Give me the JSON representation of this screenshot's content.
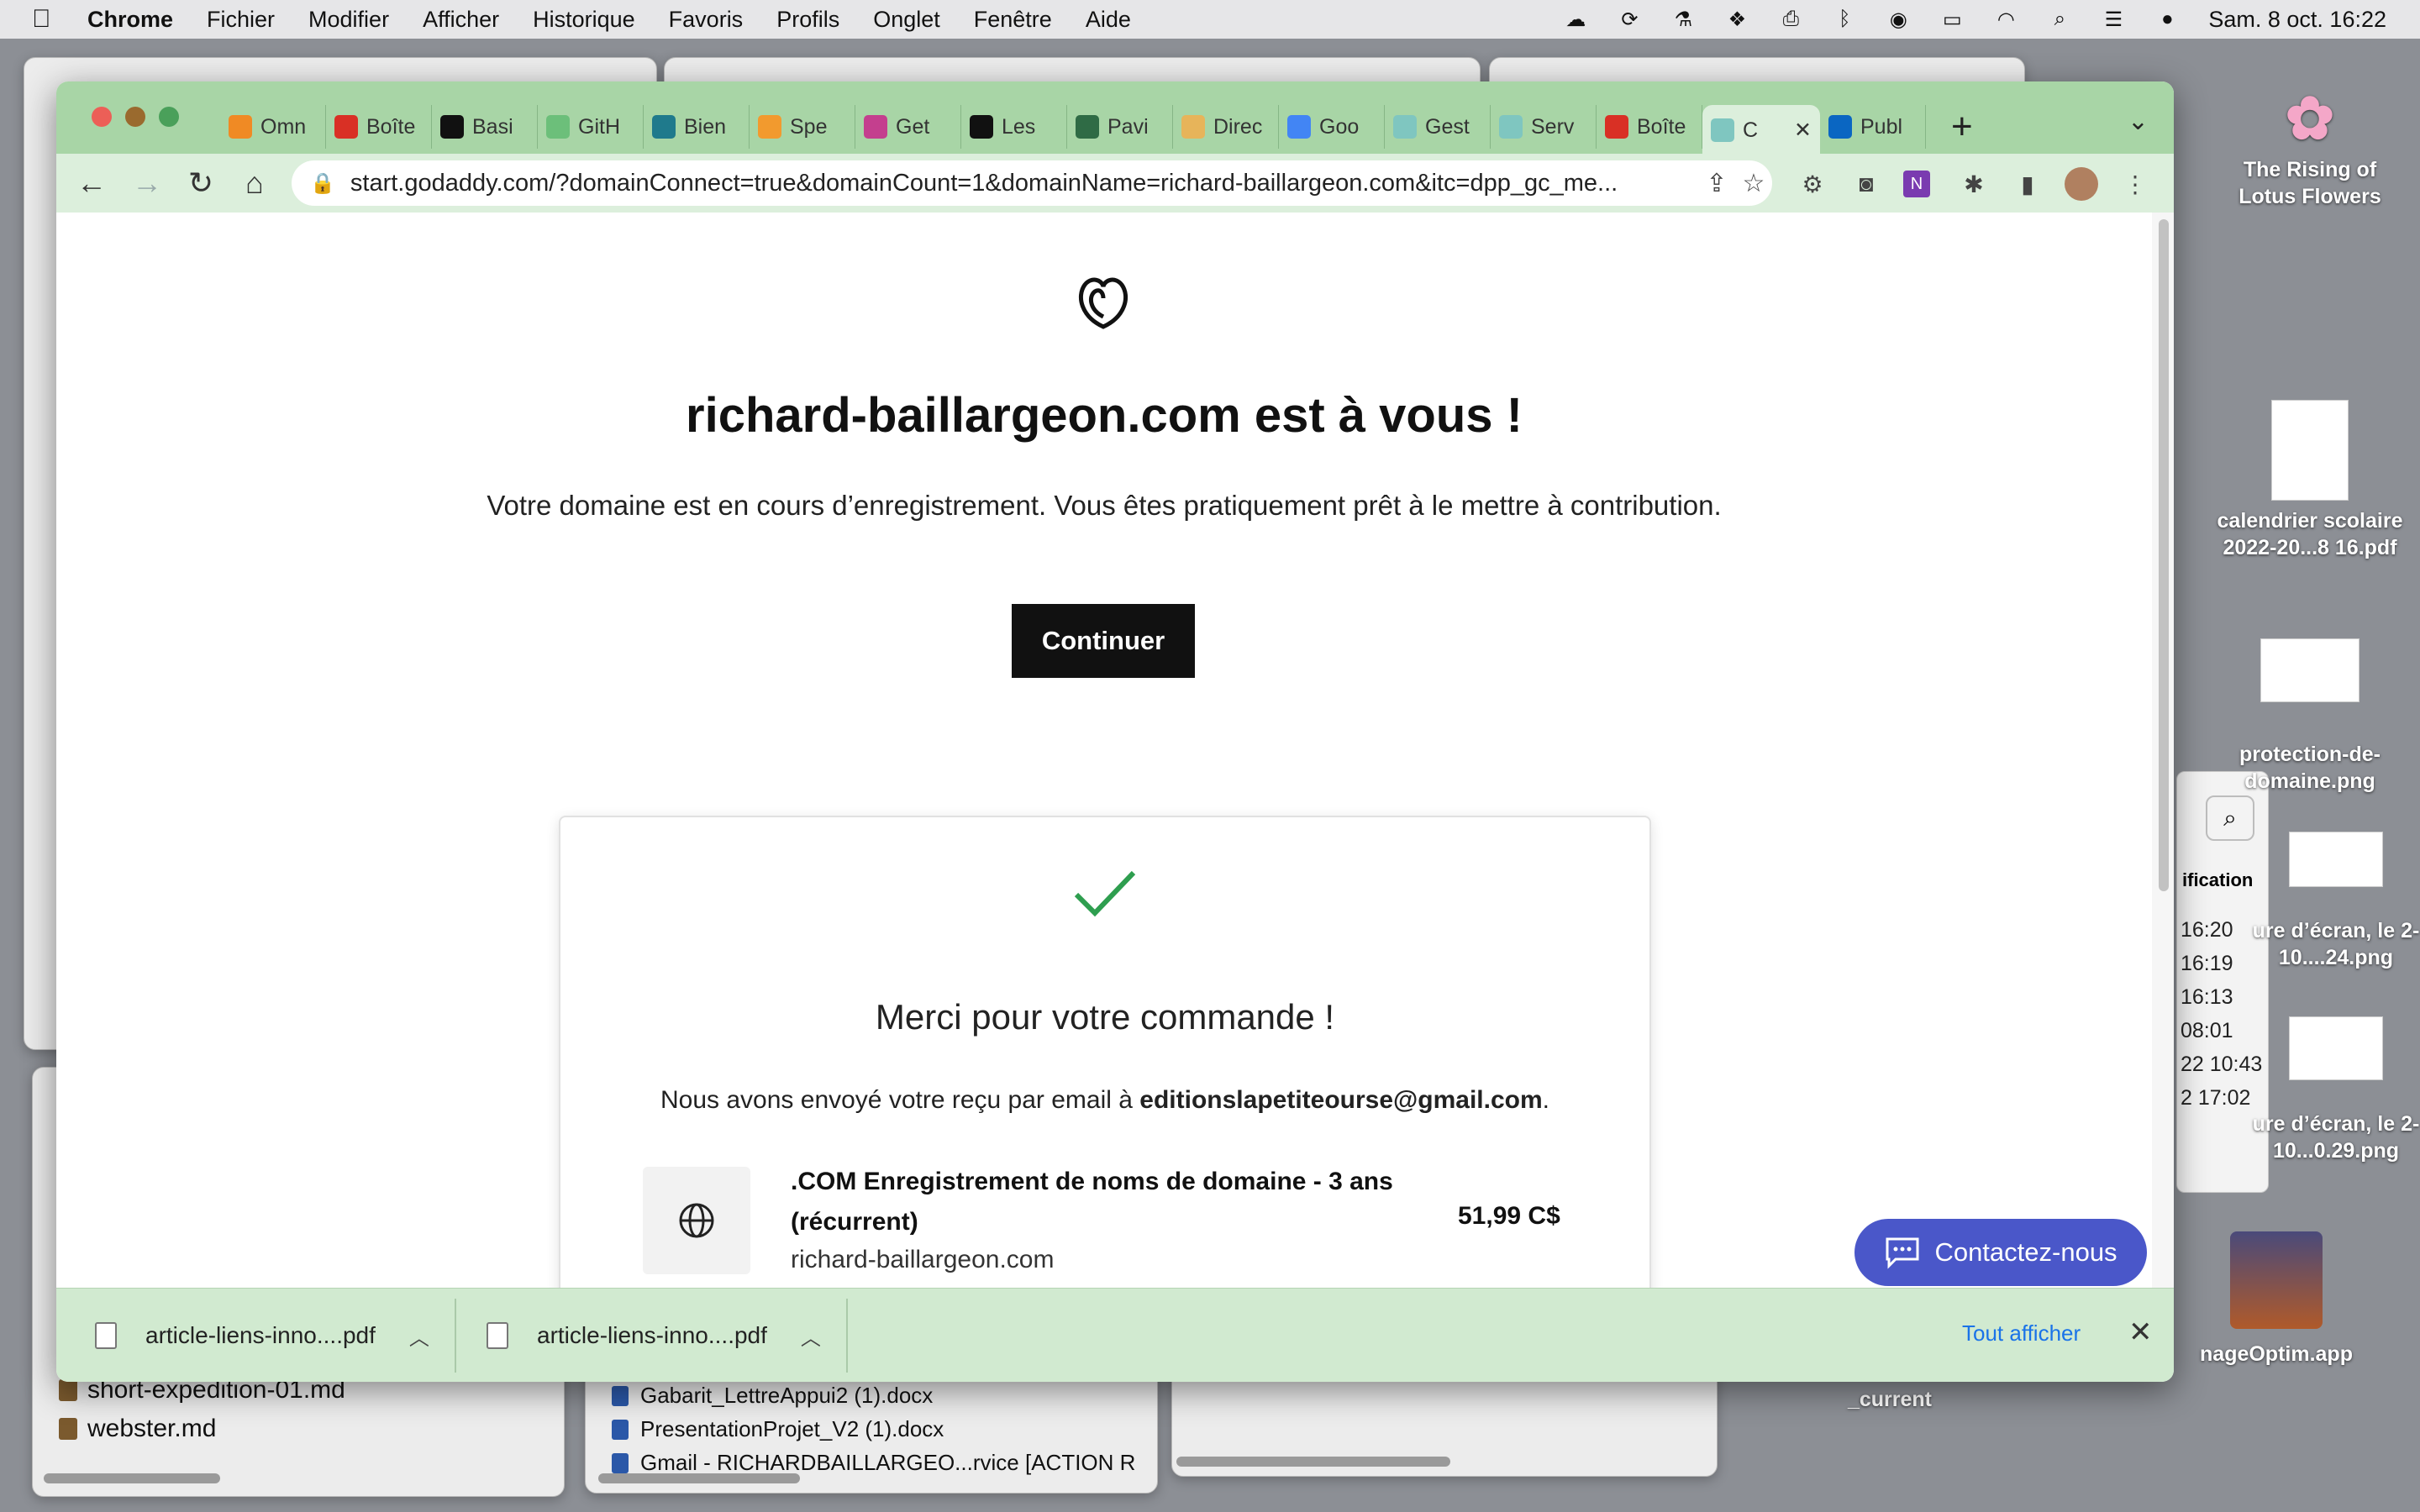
{
  "menubar": {
    "apple": "",
    "app_name": "Chrome",
    "menus": [
      "Fichier",
      "Modifier",
      "Afficher",
      "Historique",
      "Favoris",
      "Profils",
      "Onglet",
      "Fenêtre",
      "Aide"
    ],
    "clock": "Sam. 8 oct.  16:22"
  },
  "desktop": {
    "icons": [
      {
        "label": "The Rising of Lotus Flowers"
      },
      {
        "label": "calendrier scolaire 2022-20...8 16.pdf"
      },
      {
        "label": "protection-de-domaine.png"
      },
      {
        "label": "ure d’écran, le 2-10....24.png"
      },
      {
        "label": "ure d’écran, le 2-10...0.29.png"
      },
      {
        "label": "nageOptim.app"
      },
      {
        "label": "_current"
      }
    ],
    "finder_files_left": [
      "short-expedition-01.md",
      "webster.md"
    ],
    "finder_files_mid": [
      "Gabarit_LettreAppui2 (1).docx",
      "PresentationProjet_V2 (1).docx",
      "Gmail - RICHARDBAILLARGEO...rvice [ACTION R"
    ],
    "finder_list": {
      "header": "ification",
      "rows": [
        "16:20",
        "16:19",
        "16:13",
        "08:01",
        "22 10:43",
        "2 17:02"
      ]
    }
  },
  "browser": {
    "tabs": [
      {
        "label": "Omn",
        "color": "#f08a24"
      },
      {
        "label": "Boîte",
        "color": "#d93025"
      },
      {
        "label": "Basi",
        "color": "#111111"
      },
      {
        "label": "GitH",
        "color": "#6cbf7a"
      },
      {
        "label": "Bien",
        "color": "#1f7a8c"
      },
      {
        "label": "Spe",
        "color": "#f29a2e"
      },
      {
        "label": "Get",
        "color": "#c43f8e"
      },
      {
        "label": "Les",
        "color": "#111111"
      },
      {
        "label": "Pavi",
        "color": "#2f6b45"
      },
      {
        "label": "Direc",
        "color": "#e7b45a"
      },
      {
        "label": "Goo",
        "color": "#4285f4"
      },
      {
        "label": "Gest",
        "color": "#7fc6c0"
      },
      {
        "label": "Serv",
        "color": "#7fc6c0"
      },
      {
        "label": "Boîte",
        "color": "#d93025"
      },
      {
        "label": "C",
        "color": "#7fc6c0",
        "active": true
      },
      {
        "label": "Publ",
        "color": "#0a66c2"
      }
    ],
    "url": "start.godaddy.com/?domainConnect=true&domainCount=1&domainName=richard-baillargeon.com&itc=dpp_gc_me...",
    "page": {
      "title": "richard-baillargeon.com est à vous !",
      "subtitle": "Votre domaine est en cours d’enregistrement. Vous êtes pratiquement prêt à le mettre à contribution.",
      "continue_label": "Continuer",
      "thanks": "Merci pour votre commande !",
      "receipt_prefix": "Nous avons envoyé votre reçu par email à ",
      "receipt_email": "editionslapetiteourse@gmail.com",
      "receipt_suffix": ".",
      "product_name": ".COM Enregistrement de noms de domaine - 3 ans (récurrent)",
      "product_price": "51,99 C$",
      "product_domain": "richard-baillargeon.com",
      "contact_label": "Contactez-nous"
    },
    "downloads": [
      {
        "name": "article-liens-inno....pdf"
      },
      {
        "name": "article-liens-inno....pdf"
      }
    ],
    "show_all_label": "Tout afficher"
  },
  "colors": {
    "tabstrip": "#a8d5a6",
    "toolbar": "#dcefdc",
    "accent_green": "#2e9e4f",
    "contact_button": "#4a57c9",
    "link_blue": "#1a73e8"
  }
}
